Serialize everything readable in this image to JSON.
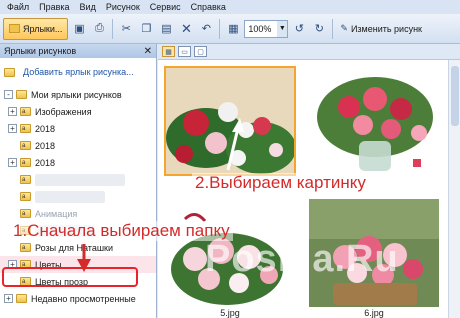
{
  "menu": [
    "Файл",
    "Правка",
    "Вид",
    "Рисунок",
    "Сервис",
    "Справка"
  ],
  "toolbar": {
    "shortcuts_label": "Ярлыки...",
    "zoom_value": "100%",
    "edit_label": "Изменить рисунк"
  },
  "left_pane": {
    "header": "Ярлыки рисунков",
    "add_link": "Добавить ярлык рисунка...",
    "tree": [
      {
        "label": "Мои ярлыки рисунков",
        "level": 0,
        "expander": "-"
      },
      {
        "label": "Изображения",
        "level": 1,
        "expander": "+"
      },
      {
        "label": "2018",
        "level": 1,
        "expander": "+"
      },
      {
        "label": "2018",
        "level": 1,
        "expander": ""
      },
      {
        "label": "2018",
        "level": 1,
        "expander": "+"
      },
      {
        "label": "",
        "level": 1,
        "expander": "",
        "blurred": true
      },
      {
        "label": "",
        "level": 1,
        "expander": "",
        "blurred": true
      },
      {
        "label": "Анимация",
        "level": 1,
        "expander": ""
      },
      {
        "label": "",
        "level": 1,
        "expander": "",
        "blurred": true
      },
      {
        "label": "Розы для Наташки",
        "level": 1,
        "expander": ""
      },
      {
        "label": "Цветы",
        "level": 1,
        "expander": "+",
        "selected": true
      },
      {
        "label": "Цветы прозр",
        "level": 1,
        "expander": ""
      },
      {
        "label": "Недавно просмотренные",
        "level": 0,
        "expander": "+"
      }
    ]
  },
  "right_pane": {
    "thumbs": [
      {
        "caption": ""
      },
      {
        "caption": ""
      },
      {
        "caption": "5.jpg"
      },
      {
        "caption": "6.jpg"
      }
    ]
  },
  "annotations": {
    "step1": "1.Сначала выбираем папку",
    "step2": "2.Выбираем картинку",
    "watermark": "Posilla.Ru"
  },
  "colors": {
    "annotation": "#d52a2a",
    "highlight": "#e8232a",
    "selection": "#f3a52e"
  }
}
